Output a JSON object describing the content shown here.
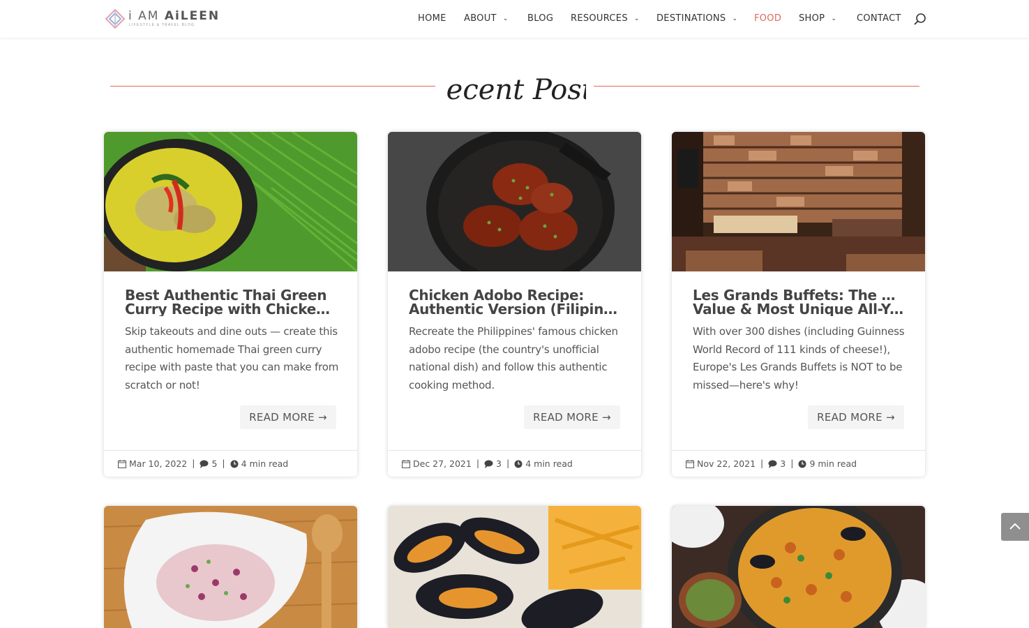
{
  "logo": {
    "text_prefix": "i AM ",
    "text_main": "AiLEEN",
    "tagline": "LIFESTYLE & TRAVEL BLOG"
  },
  "nav": [
    {
      "label": "HOME",
      "has_dropdown": false,
      "active": false
    },
    {
      "label": "ABOUT",
      "has_dropdown": true,
      "active": false
    },
    {
      "label": "BLOG",
      "has_dropdown": false,
      "active": false
    },
    {
      "label": "RESOURCES",
      "has_dropdown": true,
      "active": false
    },
    {
      "label": "DESTINATIONS",
      "has_dropdown": true,
      "active": false
    },
    {
      "label": "FOOD",
      "has_dropdown": false,
      "active": true
    },
    {
      "label": "SHOP",
      "has_dropdown": true,
      "active": false
    },
    {
      "label": "CONTACT",
      "has_dropdown": false,
      "active": false
    }
  ],
  "search": {
    "icon": "search-icon"
  },
  "section": {
    "title": "Recent Posts",
    "accent_color": "#e0675e"
  },
  "posts": [
    {
      "title_line1": "Best Authentic Thai Green",
      "title_line2": "Curry Recipe with Chicken...",
      "excerpt": "Skip takeouts and dine outs — create this authentic homemade Thai green curry recipe with paste that you can make from scratch or not!",
      "read_more": "READ MORE →",
      "date": "Mar 10, 2022",
      "comments": "5",
      "read_time": "4 min read"
    },
    {
      "title_line1": "Chicken Adobo Recipe:",
      "title_line2": "Authentic Version (Filipino...",
      "excerpt": "Recreate the Philippines' famous chicken adobo recipe (the country's unofficial national dish) and follow this authentic cooking method.",
      "read_more": "READ MORE →",
      "date": "Dec 27, 2021",
      "comments": "3",
      "read_time": "4 min read"
    },
    {
      "title_line1": "Les Grands Buffets: The Best",
      "title_line2": "Value & Most Unique All-Yo...",
      "excerpt": "With over 300 dishes (including Guinness World Record of 111 kinds of cheese!), Europe's Les Grands Buffets is NOT to be missed—here's why!",
      "read_more": "READ MORE →",
      "date": "Nov 22, 2021",
      "comments": "3",
      "read_time": "9 min read"
    }
  ],
  "scroll_top": {
    "icon": "chevron-up-icon"
  }
}
